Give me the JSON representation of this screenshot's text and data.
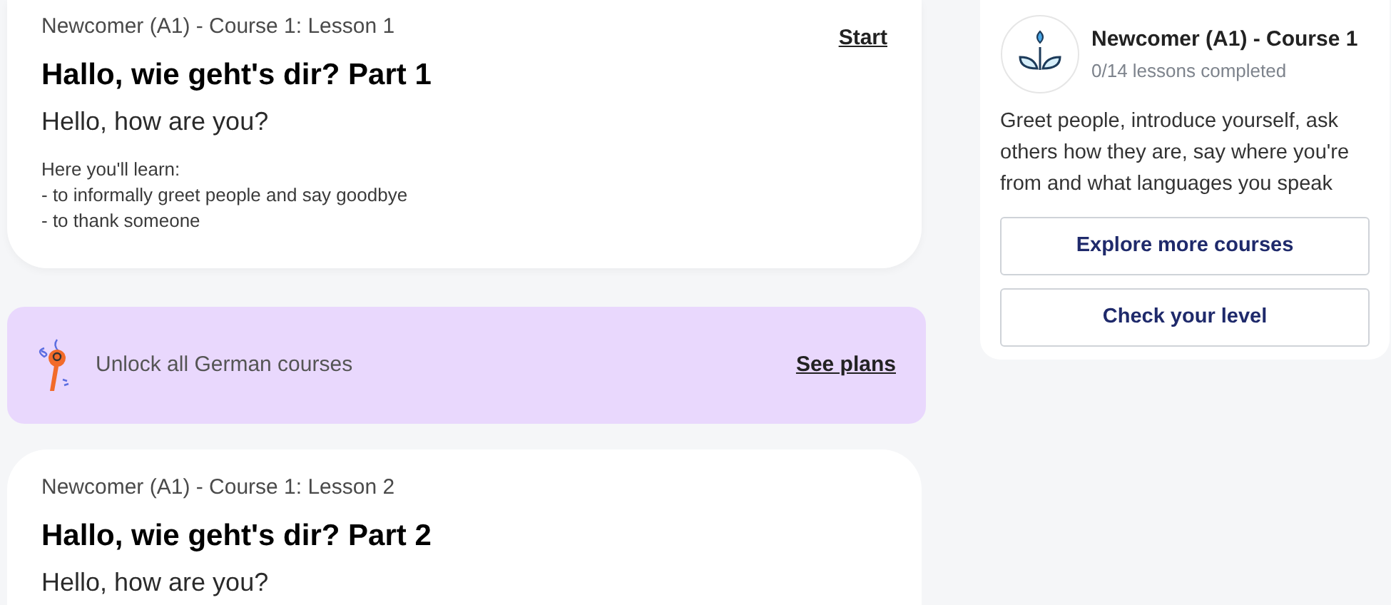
{
  "lessons": [
    {
      "course": "Newcomer (A1) - Course 1: Lesson 1",
      "title": "Hallo, wie geht's dir? Part 1",
      "translation": "Hello, how are you?",
      "learn": [
        "Here you'll learn:",
        "- to informally greet people and say goodbye",
        "- to thank someone"
      ],
      "action": "Start"
    },
    {
      "course": "Newcomer (A1) - Course 1: Lesson 2",
      "title": "Hallo, wie geht's dir? Part 2",
      "translation": "Hello, how are you?"
    }
  ],
  "banner": {
    "text": "Unlock all German courses",
    "link": "See plans"
  },
  "course_card": {
    "title": "Newcomer (A1) - Course 1",
    "progress": "0/14 lessons completed",
    "description": "Greet people, introduce yourself, ask others how they are, say where you're from and what languages you speak",
    "buttons": [
      "Explore more courses",
      "Check your level"
    ]
  }
}
